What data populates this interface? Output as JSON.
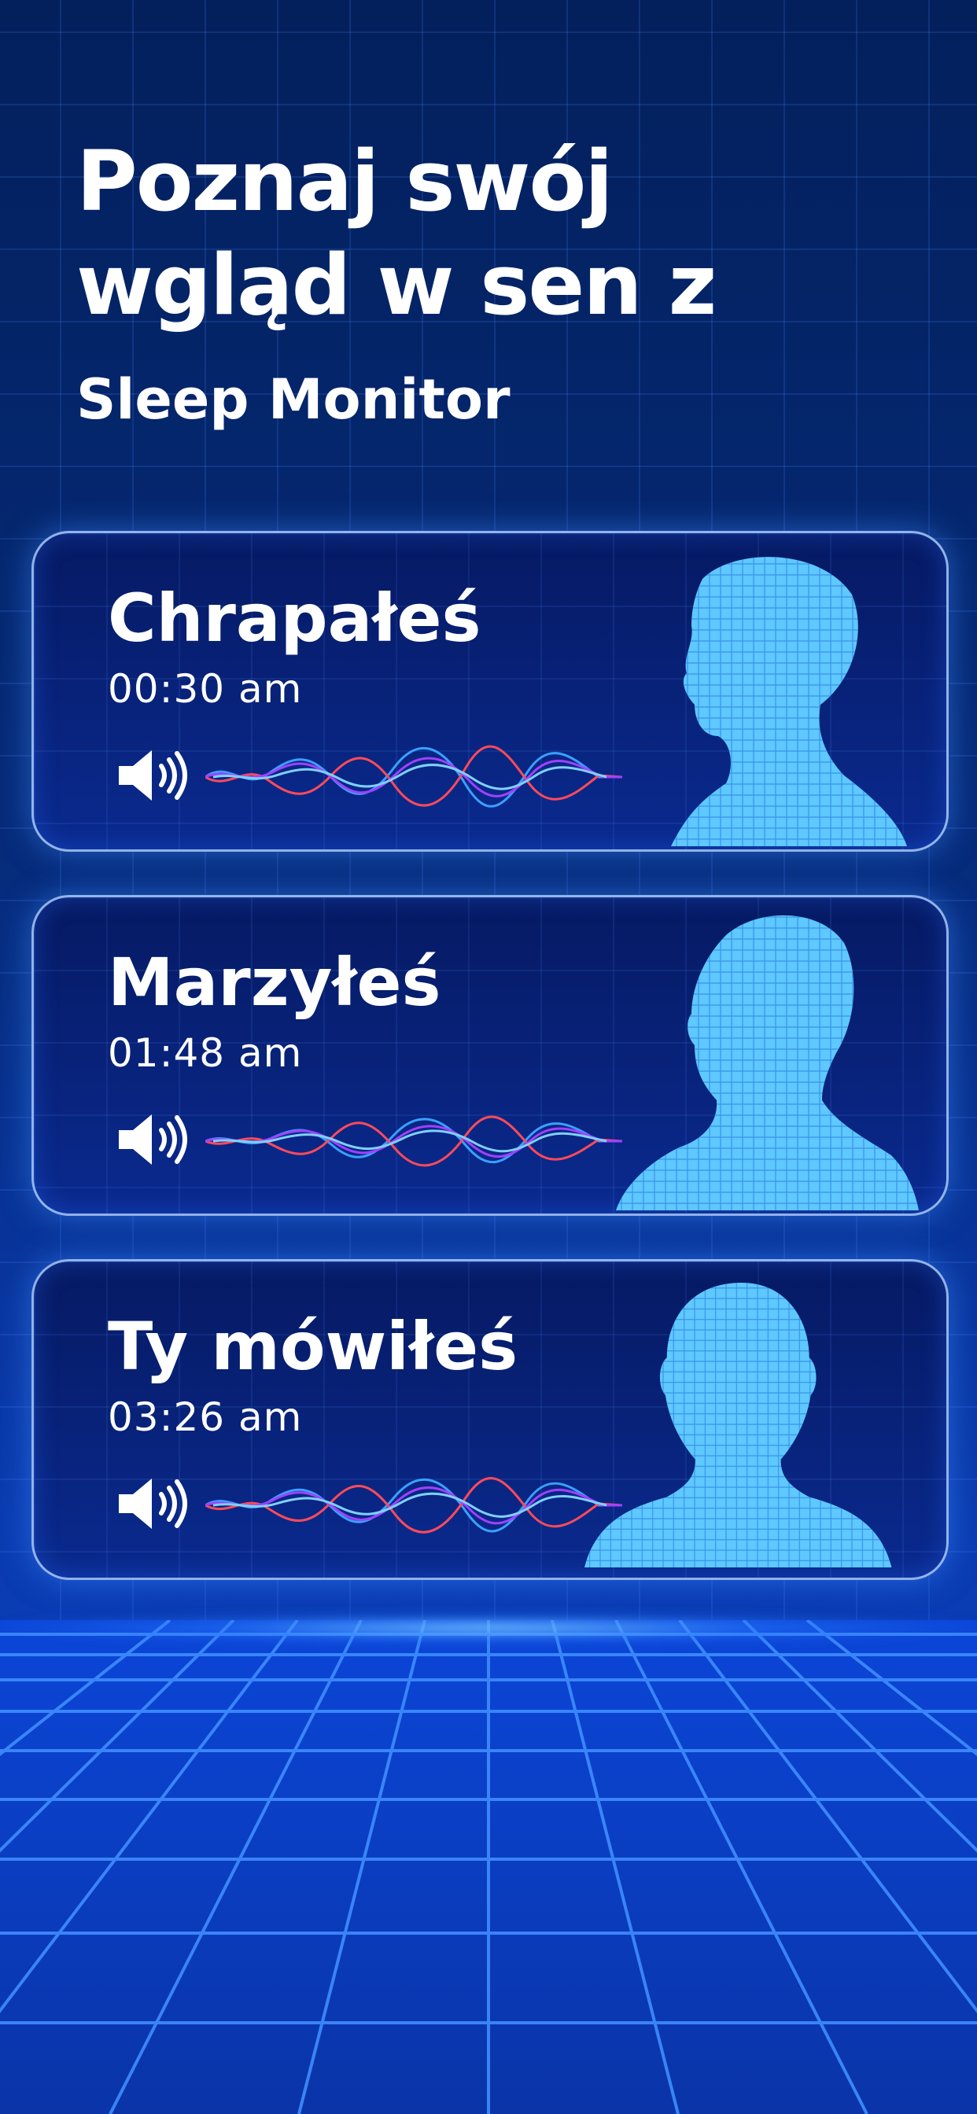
{
  "header": {
    "headline_line1": "Poznaj swój",
    "headline_line2": "wgląd w sen z",
    "subtitle": "Sleep Monitor"
  },
  "cards": [
    {
      "title": "Chrapałeś",
      "time": "00:30 am",
      "icon": "speaker-icon",
      "head_pose": "side"
    },
    {
      "title": "Marzyłeś",
      "time": "01:48 am",
      "icon": "speaker-icon",
      "head_pose": "three-quarter"
    },
    {
      "title": "Ty mówiłeś",
      "time": "03:26 am",
      "icon": "speaker-icon",
      "head_pose": "front"
    }
  ],
  "colors": {
    "background_top": "#03205c",
    "background_bottom": "#0b3fc8",
    "card_border": "#aacdff",
    "head": "#5ec8ff",
    "wave_blue": "#3aa0ff",
    "wave_red": "#ff4a5a",
    "wave_purple": "#a040ff"
  }
}
